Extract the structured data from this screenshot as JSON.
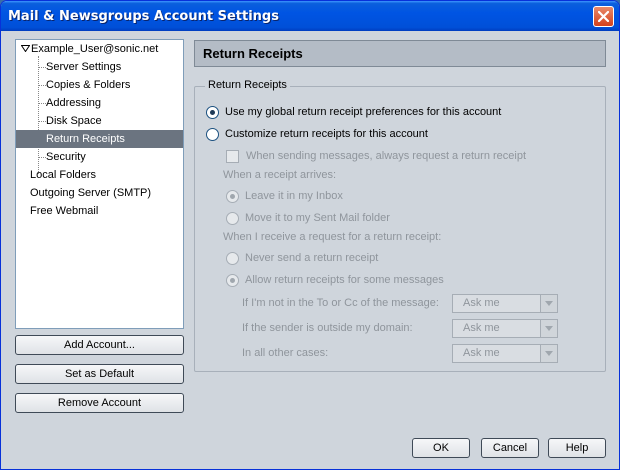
{
  "window": {
    "title": "Mail & Newsgroups Account Settings",
    "close_glyph": "×"
  },
  "tree": {
    "account": "Example_User@sonic.net",
    "children": [
      "Server Settings",
      "Copies & Folders",
      "Addressing",
      "Disk Space",
      "Return Receipts",
      "Security"
    ],
    "others": [
      "Local Folders",
      "Outgoing Server (SMTP)",
      "Free Webmail"
    ],
    "selected": "Return Receipts"
  },
  "left_buttons": {
    "add_account": "Add Account...",
    "set_default": "Set as Default",
    "remove_account": "Remove Account"
  },
  "panel": {
    "header": "Return Receipts",
    "group_label": "Return Receipts",
    "use_global_label": "Use my global return receipt preferences for this account",
    "customize_label": "Customize return receipts for this account",
    "always_request_label": "When sending messages, always request a return receipt",
    "when_arrives_label": "When a receipt arrives:",
    "leave_inbox_label": "Leave it in my Inbox",
    "move_sent_label": "Move it to my Sent Mail folder",
    "when_request_label": "When I receive a request for a return receipt:",
    "never_send_label": "Never send a return receipt",
    "allow_some_label": "Allow return receipts for some messages",
    "not_in_to_cc_label": "If I'm not in the To or Cc of the message:",
    "outside_domain_label": "If the sender is outside my domain:",
    "all_other_label": "In all other cases:",
    "not_in_to_cc_value": "Ask me",
    "outside_domain_value": "Ask me",
    "all_other_value": "Ask me"
  },
  "footer": {
    "ok": "OK",
    "cancel": "Cancel",
    "help": "Help"
  },
  "colors": {
    "title_bar": "#0054e3",
    "selection": "#6b7480",
    "dialog_bg": "#cfd5dc"
  }
}
